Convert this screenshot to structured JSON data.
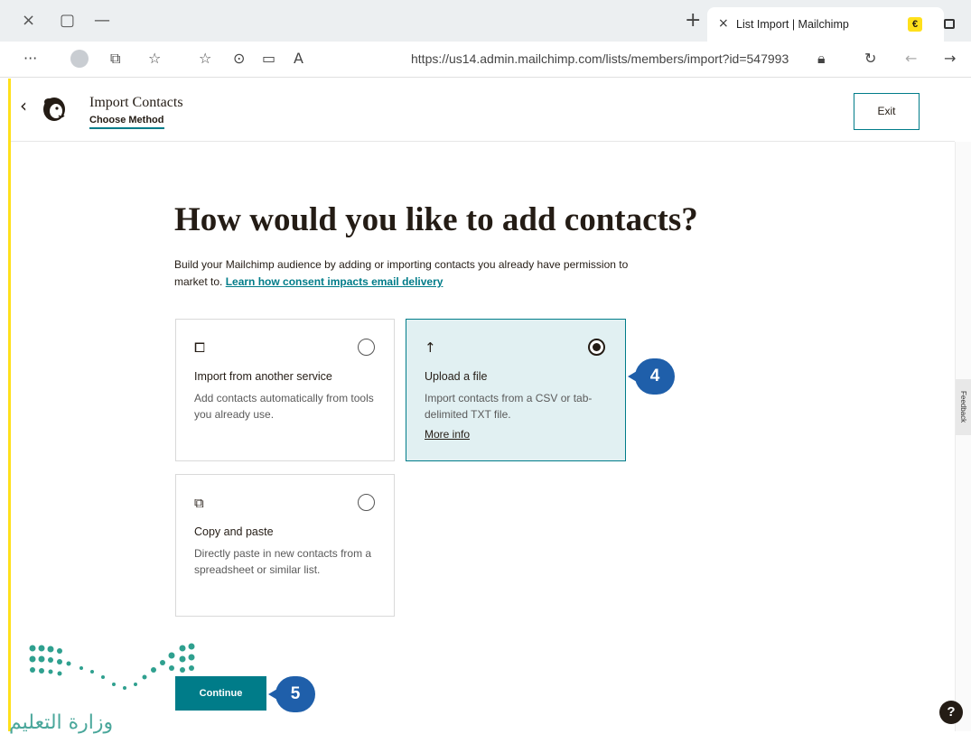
{
  "browser": {
    "tab_title": "List Import | Mailchimp",
    "url": "https://us14.admin.mailchimp.com/lists/members/import?id=547993",
    "close_glyph": "×",
    "minimize_glyph": "—",
    "restore_glyph": "▢",
    "newtab_glyph": "+",
    "tab_close_glyph": "×",
    "more_glyph": "···",
    "favicon_glyph": "€"
  },
  "header": {
    "back_glyph": "‹",
    "title": "Import Contacts",
    "step": "Choose Method",
    "exit_label": "Exit"
  },
  "main": {
    "question": "How would you like to add contacts?",
    "description": "Build your Mailchimp audience by adding or importing contacts you already have permission to market to.",
    "learn_link": "Learn how consent impacts email delivery",
    "options": [
      {
        "icon": "import-service-icon",
        "title": "Import from another service",
        "description": "Add contacts automatically from tools you already use.",
        "selected": false
      },
      {
        "icon": "upload-arrow-icon",
        "title": "Upload a file",
        "description": "Import contacts from a CSV or tab-delimited TXT file.",
        "link": "More info",
        "selected": true
      },
      {
        "icon": "copy-icon",
        "title": "Copy and paste",
        "description": "Directly paste in new contacts from a spreadsheet or similar list.",
        "selected": false
      }
    ],
    "continue_label": "Continue"
  },
  "annotations": {
    "step4": "4",
    "step5": "5"
  },
  "feedback_label": "Feedback",
  "help_label": "?",
  "watermark": "وزارة التعليم",
  "colors": {
    "accent": "#007c89",
    "selected_bg": "#e1f0f2",
    "callout": "#1f5faa",
    "brand_yellow": "#ffe01b"
  }
}
